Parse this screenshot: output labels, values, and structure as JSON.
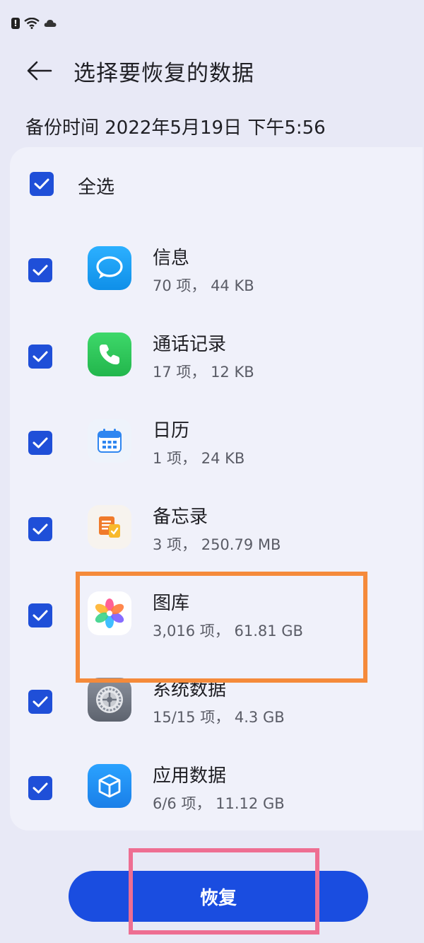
{
  "header": {
    "title": "选择要恢复的数据"
  },
  "backup": {
    "time_text": "备份时间 2022年5月19日 下午5:56"
  },
  "select_all": {
    "label": "全选",
    "checked": true
  },
  "items": [
    {
      "name": "信息",
      "meta": "70 项， 44 KB",
      "checked": true,
      "icon": "messages-icon",
      "icon_color": "#1a9cf0"
    },
    {
      "name": "通话记录",
      "meta": "17 项， 12 KB",
      "checked": true,
      "icon": "phone-icon",
      "icon_color": "#2fc65b"
    },
    {
      "name": "日历",
      "meta": "1 项， 24 KB",
      "checked": true,
      "icon": "calendar-icon",
      "icon_color": "#2f86f0"
    },
    {
      "name": "备忘录",
      "meta": "3 项， 250.79 MB",
      "checked": true,
      "icon": "notes-icon",
      "icon_color": "#f07a2a"
    },
    {
      "name": "图库",
      "meta": "3,016 项， 61.81 GB",
      "checked": true,
      "icon": "gallery-icon",
      "icon_color": "#ff4f8b"
    },
    {
      "name": "系统数据",
      "meta": "15/15 项， 4.3 GB",
      "checked": true,
      "icon": "settings-icon",
      "icon_color": "#6e7480"
    },
    {
      "name": "应用数据",
      "meta": "6/6 项， 11.12 GB",
      "checked": true,
      "icon": "app-data-icon",
      "icon_color": "#1e8ef0"
    }
  ],
  "footer": {
    "restore_label": "恢复"
  },
  "colors": {
    "accent": "#1a4de0",
    "highlight_orange": "#f58a3a",
    "highlight_pink": "#ee6e92"
  }
}
